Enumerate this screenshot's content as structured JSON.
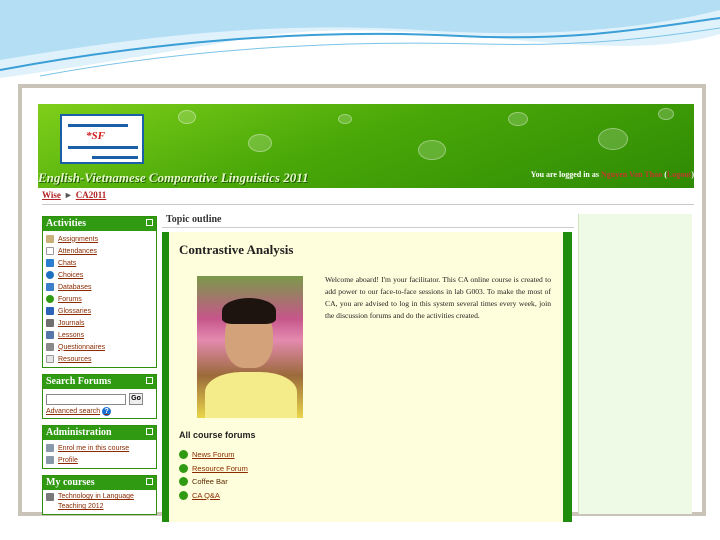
{
  "site": {
    "title": "English-Vietnamese Comparative Linguistics 2011",
    "logged_in_prefix": "You are logged in as",
    "user_name": "Nguyen Van Thao",
    "logout_label": "Logout"
  },
  "logo": {
    "mark": "*SF"
  },
  "breadcrumb": {
    "home": "Wise",
    "separator": "►",
    "course": "CA2011"
  },
  "activities": {
    "title": "Activities",
    "items": [
      {
        "label": "Assignments",
        "icon": "assignment-icon"
      },
      {
        "label": "Attendances",
        "icon": "attendance-icon"
      },
      {
        "label": "Chats",
        "icon": "chat-icon"
      },
      {
        "label": "Choices",
        "icon": "choice-icon"
      },
      {
        "label": "Databases",
        "icon": "database-icon"
      },
      {
        "label": "Forums",
        "icon": "forum-icon"
      },
      {
        "label": "Glossaries",
        "icon": "glossary-icon"
      },
      {
        "label": "Journals",
        "icon": "journal-icon"
      },
      {
        "label": "Lessons",
        "icon": "lesson-icon"
      },
      {
        "label": "Questionnaires",
        "icon": "questionnaire-icon"
      },
      {
        "label": "Resources",
        "icon": "resource-icon"
      }
    ]
  },
  "search_forums": {
    "title": "Search Forums",
    "go_label": "Go",
    "advanced_label": "Advanced search",
    "help_label": "?"
  },
  "administration": {
    "title": "Administration",
    "items": [
      {
        "label": "Enrol me in this course"
      },
      {
        "label": "Profile"
      }
    ]
  },
  "my_courses": {
    "title": "My courses",
    "items": [
      {
        "label": "Technology in Language Teaching 2012"
      }
    ]
  },
  "main": {
    "topic_outline": "Topic outline",
    "section_title": "Contrastive Analysis",
    "welcome_text": "Welcome aboard! I'm your facilitator. This CA online course is created to add power to our face-to-face sessions in lab G003. To make the most of CA, you are advised to log in this system several times every week, join the discussion forums and do the activities created.",
    "forums_heading": "All course forums",
    "forums": [
      {
        "label": "News Forum",
        "linked": true
      },
      {
        "label": "Resource Forum",
        "linked": true
      },
      {
        "label": "Coffee Bar",
        "linked": false
      },
      {
        "label": "CA Q&A",
        "linked": true
      }
    ]
  },
  "colors": {
    "banner_green": "#3a9a0a",
    "block_header": "#2f9a12",
    "link": "#8a2b00",
    "section_bg": "#fffedc"
  }
}
